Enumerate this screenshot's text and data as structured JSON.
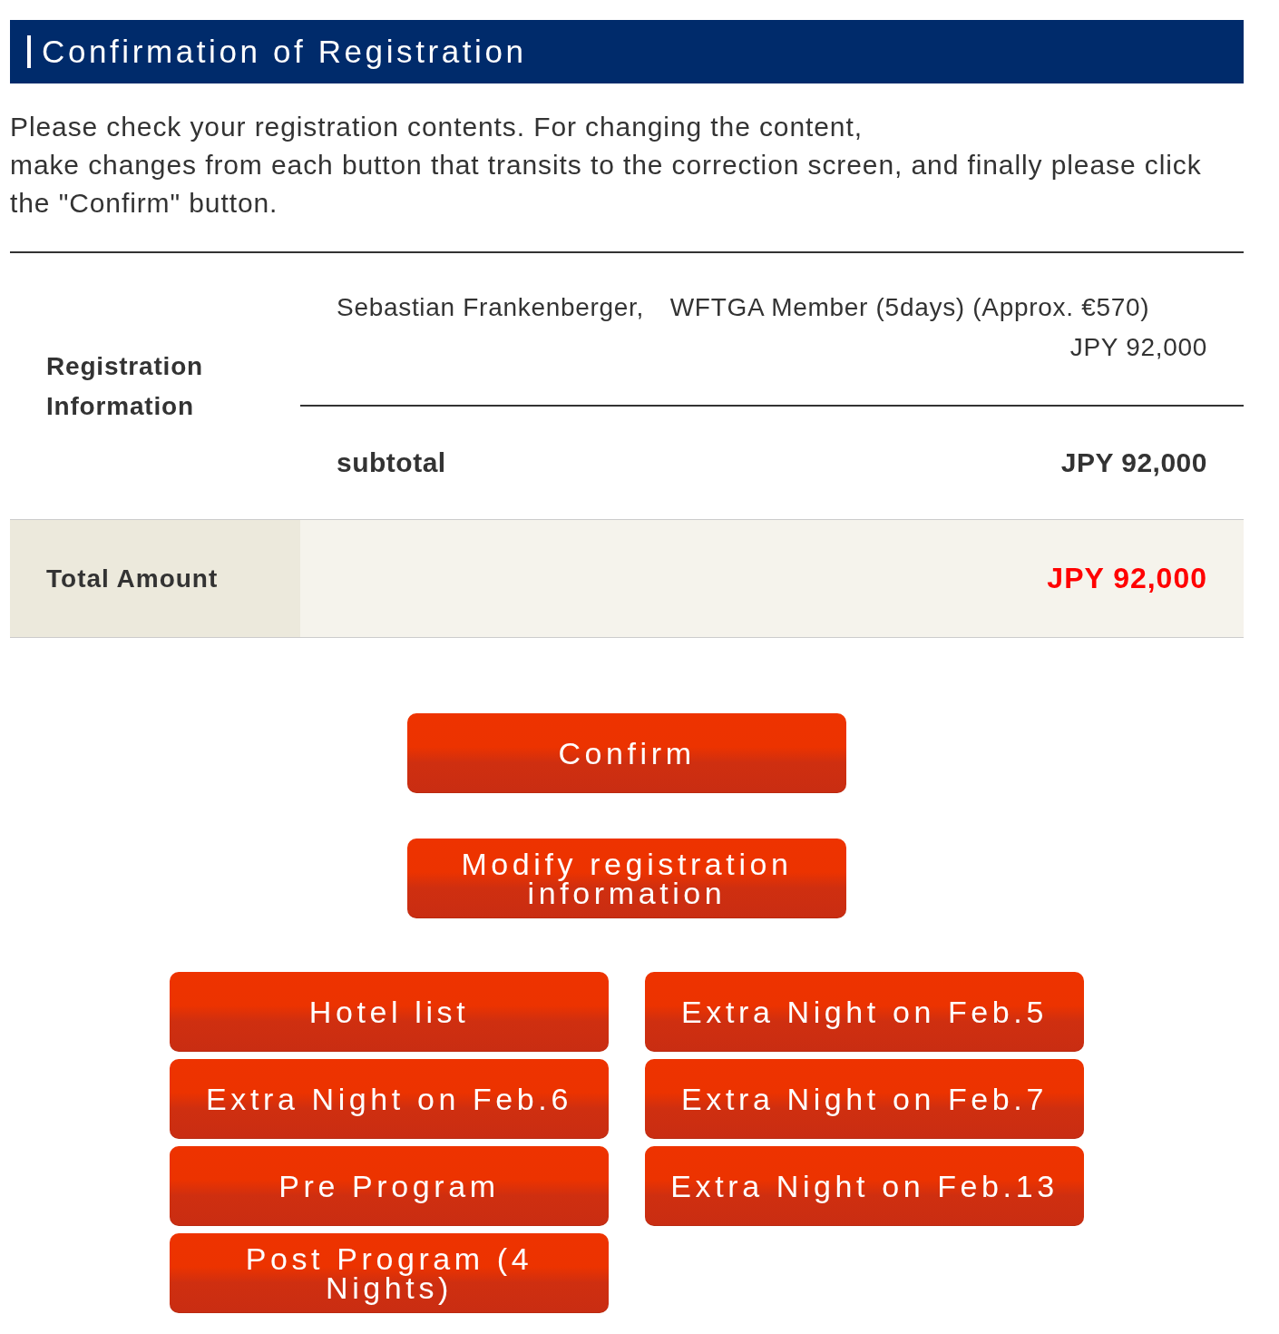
{
  "header": {
    "title": "Confirmation of Registration"
  },
  "intro": [
    "Please check your registration contents. For changing the content,",
    "make changes from each button that transits to the correction screen, and finally please click the \"Confirm\" button."
  ],
  "registration": {
    "label": "Registration Information",
    "items": [
      {
        "description": "Sebastian Frankenberger,　WFTGA Member (5days) (Approx. €570)",
        "amount": "JPY 92,000"
      }
    ],
    "subtotal": {
      "label": "subtotal",
      "amount": "JPY 92,000"
    }
  },
  "total": {
    "label": "Total Amount",
    "amount": "JPY 92,000"
  },
  "actions": [
    "Confirm",
    "Modify registration information"
  ],
  "option_buttons": [
    "Hotel list",
    "Extra Night on Feb.5",
    "Extra Night on Feb.6",
    "Extra Night on Feb.7",
    "Pre Program",
    "Extra Night on Feb.13",
    "Post Program (4 Nights)"
  ]
}
